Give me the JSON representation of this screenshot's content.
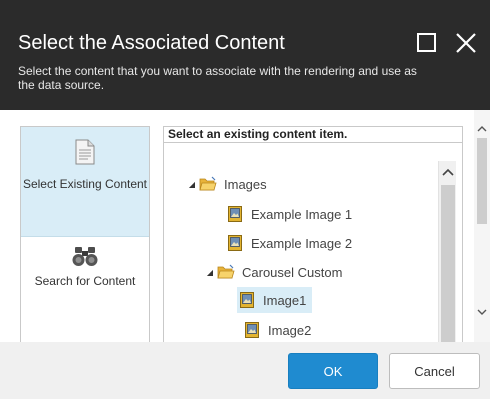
{
  "dialog": {
    "title": "Select the Associated Content",
    "subtitle": "Select the content that you want to associate with the rendering and use as the data source.",
    "header_bg": "#2b2b2b"
  },
  "nav": {
    "items": [
      {
        "label": "Select Existing Content",
        "icon": "document-icon",
        "active": true
      },
      {
        "label": "Search for Content",
        "icon": "binoculars-icon",
        "active": false
      }
    ]
  },
  "tree": {
    "heading": "Select an existing content item.",
    "nodes": [
      {
        "label": "Images",
        "icon": "folder-icon",
        "expanded": true
      },
      {
        "label": "Example Image 1",
        "icon": "image-icon"
      },
      {
        "label": "Example Image 2",
        "icon": "image-icon"
      },
      {
        "label": "Carousel Custom",
        "icon": "folder-icon",
        "expanded": true
      },
      {
        "label": "Image1",
        "icon": "image-icon",
        "selected": true
      },
      {
        "label": "Image2",
        "icon": "image-icon"
      }
    ]
  },
  "footer": {
    "ok_label": "OK",
    "cancel_label": "Cancel",
    "accent": "#1f8bd0",
    "selection_bg": "#d9edf7"
  }
}
